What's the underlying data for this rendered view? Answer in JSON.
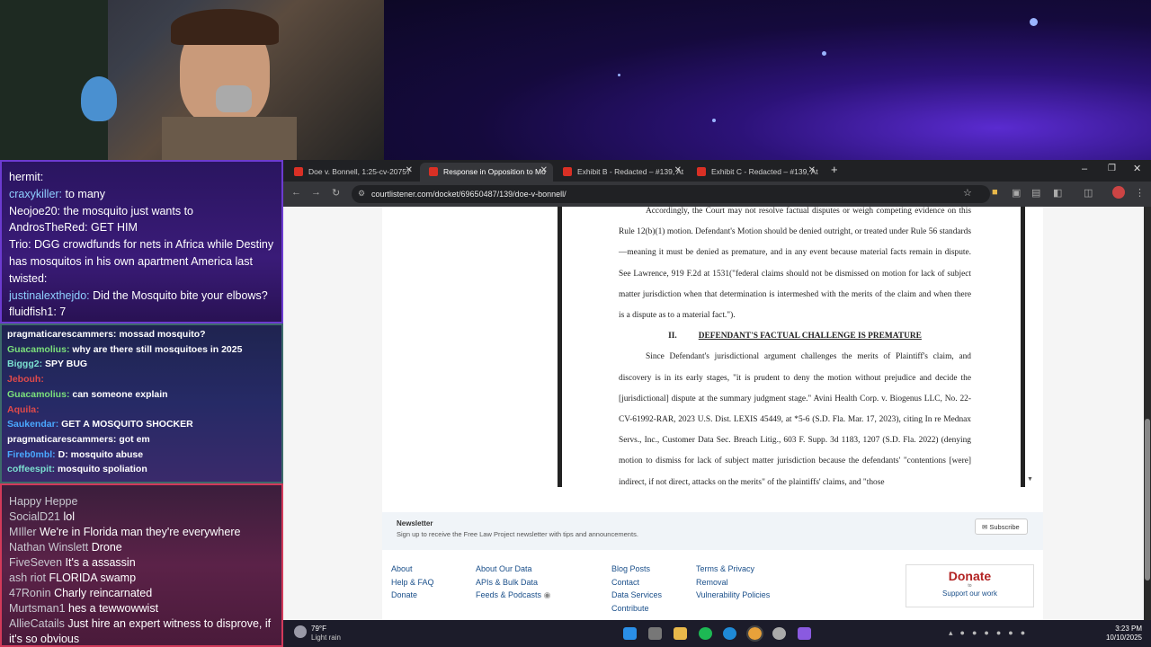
{
  "chat1": {
    "lines": [
      {
        "user": "hermit:",
        "msg": ""
      },
      {
        "user": "craxykiller:",
        "msg": "to many"
      },
      {
        "user": "Neojoe20:",
        "msg": "the mosquito just wants to"
      },
      {
        "user": "AndrosTheRed:",
        "msg": "GET HIM"
      },
      {
        "user": "Trio:",
        "msg": "DGG crowdfunds for nets in Africa while Destiny has mosquitos in his own apartment"
      },
      {
        "user": "",
        "msg": "America last"
      },
      {
        "user": "twisted:",
        "msg": ""
      },
      {
        "user": "justinalexthejdo:",
        "msg": "Did the Mosquito bite your elbows?"
      },
      {
        "user": "fluidfish1:",
        "msg": "7"
      }
    ]
  },
  "chat2": {
    "lines": [
      {
        "user": "pragmaticarescammers:",
        "msg": "mossad mosquito?"
      },
      {
        "user": "Guacamolius:",
        "msg": "why are there still mosquitoes in 2025"
      },
      {
        "user": "Biggg2:",
        "msg": "SPY BUG"
      },
      {
        "user": "Jebouh:",
        "msg": ""
      },
      {
        "user": "Guacamolius:",
        "msg": "can someone explain"
      },
      {
        "user": "Aquila:",
        "msg": ""
      },
      {
        "user": "Saukendar:",
        "msg": "GET A MOSQUITO SHOCKER"
      },
      {
        "user": "pragmaticarescammers:",
        "msg": "got em"
      },
      {
        "user": "Fireb0mbl:",
        "msg": "D: mosquito abuse"
      },
      {
        "user": "coffeespit:",
        "msg": "mosquito spoliation"
      }
    ]
  },
  "chat3": {
    "lines": [
      {
        "user": "Happy Heppe",
        "msg": ""
      },
      {
        "user": "SocialD21",
        "msg": "lol"
      },
      {
        "user": "MIller",
        "msg": "We're in Florida man they're everywhere"
      },
      {
        "user": "Nathan Winslett",
        "msg": "Drone"
      },
      {
        "user": "FiveSeven",
        "msg": "It's a assassin"
      },
      {
        "user": "ash riot",
        "msg": "FLORIDA swamp"
      },
      {
        "user": "47Ronin",
        "msg": "Charly reincarnated"
      },
      {
        "user": "Murtsman1",
        "msg": "hes a tewwowwist"
      },
      {
        "user": "AllieCatails",
        "msg": "Just hire an expert witness to disprove, if it's so obvious"
      }
    ]
  },
  "tabs": [
    {
      "label": "Doe v. Bonnell, 1:25-cv-20757"
    },
    {
      "label": "Response in Opposition to Mo"
    },
    {
      "label": "Exhibit B - Redacted – #139, At"
    },
    {
      "label": "Exhibit C - Redacted – #139, At"
    }
  ],
  "url": "courtlistener.com/docket/69650487/139/doe-v-bonnell/",
  "pdf": {
    "para1": "Accordingly, the Court may not resolve factual disputes or weigh competing evidence on this Rule 12(b)(1) motion. Defendant's Motion should be denied outright, or treated under Rule 56 standards—meaning it must be denied as premature, and in any event because material facts remain in dispute. See Lawrence, 919 F.2d at 1531(\"federal claims should not be dismissed on motion for lack of subject matter jurisdiction when that determination is intermeshed with the merits of the claim and when there is a dispute as to a material fact.\").",
    "heading_num": "II.",
    "heading": "DEFENDANT'S FACTUAL CHALLENGE IS PREMATURE",
    "para2": "Since Defendant's jurisdictional argument challenges the merits of Plaintiff's claim, and discovery is in its early stages, \"it is prudent to deny the motion without prejudice and decide the [jurisdictional] dispute at the summary judgment stage.\" Avini Health Corp. v. Biogenus LLC, No. 22-CV-61992-RAR, 2023 U.S. Dist. LEXIS 45449, at *5-6 (S.D. Fla. Mar. 17, 2023), citing In re Mednax Servs., Inc., Customer Data Sec. Breach Litig., 603 F. Supp. 3d 1183, 1207 (S.D. Fla. 2022) (denying motion to dismiss for lack of subject matter jurisdiction because the defendants' \"contentions [were] indirect, if not direct, attacks on the merits\" of the plaintiffs' claims, and \"those"
  },
  "newsletter": {
    "title": "Newsletter",
    "desc": "Sign up to receive the Free Law Project newsletter with tips and announcements.",
    "button": "Subscribe"
  },
  "footer": {
    "col1": [
      "About",
      "Help & FAQ",
      "Donate"
    ],
    "col2": [
      "About Our Data",
      "APIs & Bulk Data",
      "Feeds & Podcasts"
    ],
    "col3": [
      "Blog Posts",
      "Contact",
      "Data Services",
      "Contribute"
    ],
    "col4": [
      "Terms & Privacy",
      "Removal",
      "Vulnerability Policies"
    ],
    "donate_title": "Donate",
    "donate_to": "to",
    "donate_sub": "Support our work"
  },
  "taskbar": {
    "temp": "79°F",
    "weather": "Light rain",
    "time": "3:23 PM",
    "date": "10/10/2025"
  },
  "colors": {
    "accent": "#1a4f8a",
    "donate": "#b22222",
    "chrome_bg": "#202124"
  }
}
